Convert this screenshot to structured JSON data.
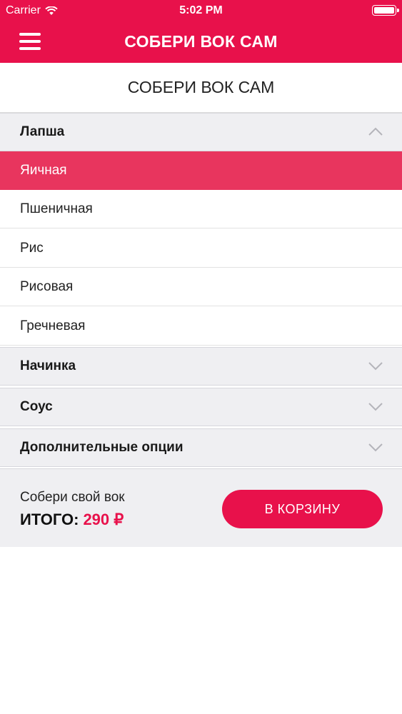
{
  "status_bar": {
    "carrier": "Carrier",
    "time": "5:02 PM"
  },
  "nav": {
    "title": "СОБЕРИ ВОК САМ",
    "menu_icon": "hamburger-menu-icon"
  },
  "page": {
    "title": "СОБЕРИ ВОК САМ"
  },
  "sections": [
    {
      "label": "Лапша",
      "expanded": true,
      "options": [
        {
          "label": "Яичная",
          "selected": true
        },
        {
          "label": "Пшеничная",
          "selected": false
        },
        {
          "label": "Рис",
          "selected": false
        },
        {
          "label": "Рисовая",
          "selected": false
        },
        {
          "label": "Гречневая",
          "selected": false
        }
      ]
    },
    {
      "label": "Начинка",
      "expanded": false
    },
    {
      "label": "Соус",
      "expanded": false
    },
    {
      "label": "Дополнительные опции",
      "expanded": false
    }
  ],
  "footer": {
    "subtitle": "Собери свой вок",
    "total_label": "ИТОГО:",
    "total_value": "290 ₽",
    "cart_button": "В КОРЗИНУ"
  },
  "colors": {
    "brand": "#e8114b",
    "selected_row": "#e8355e",
    "section_bg": "#efeff2"
  }
}
